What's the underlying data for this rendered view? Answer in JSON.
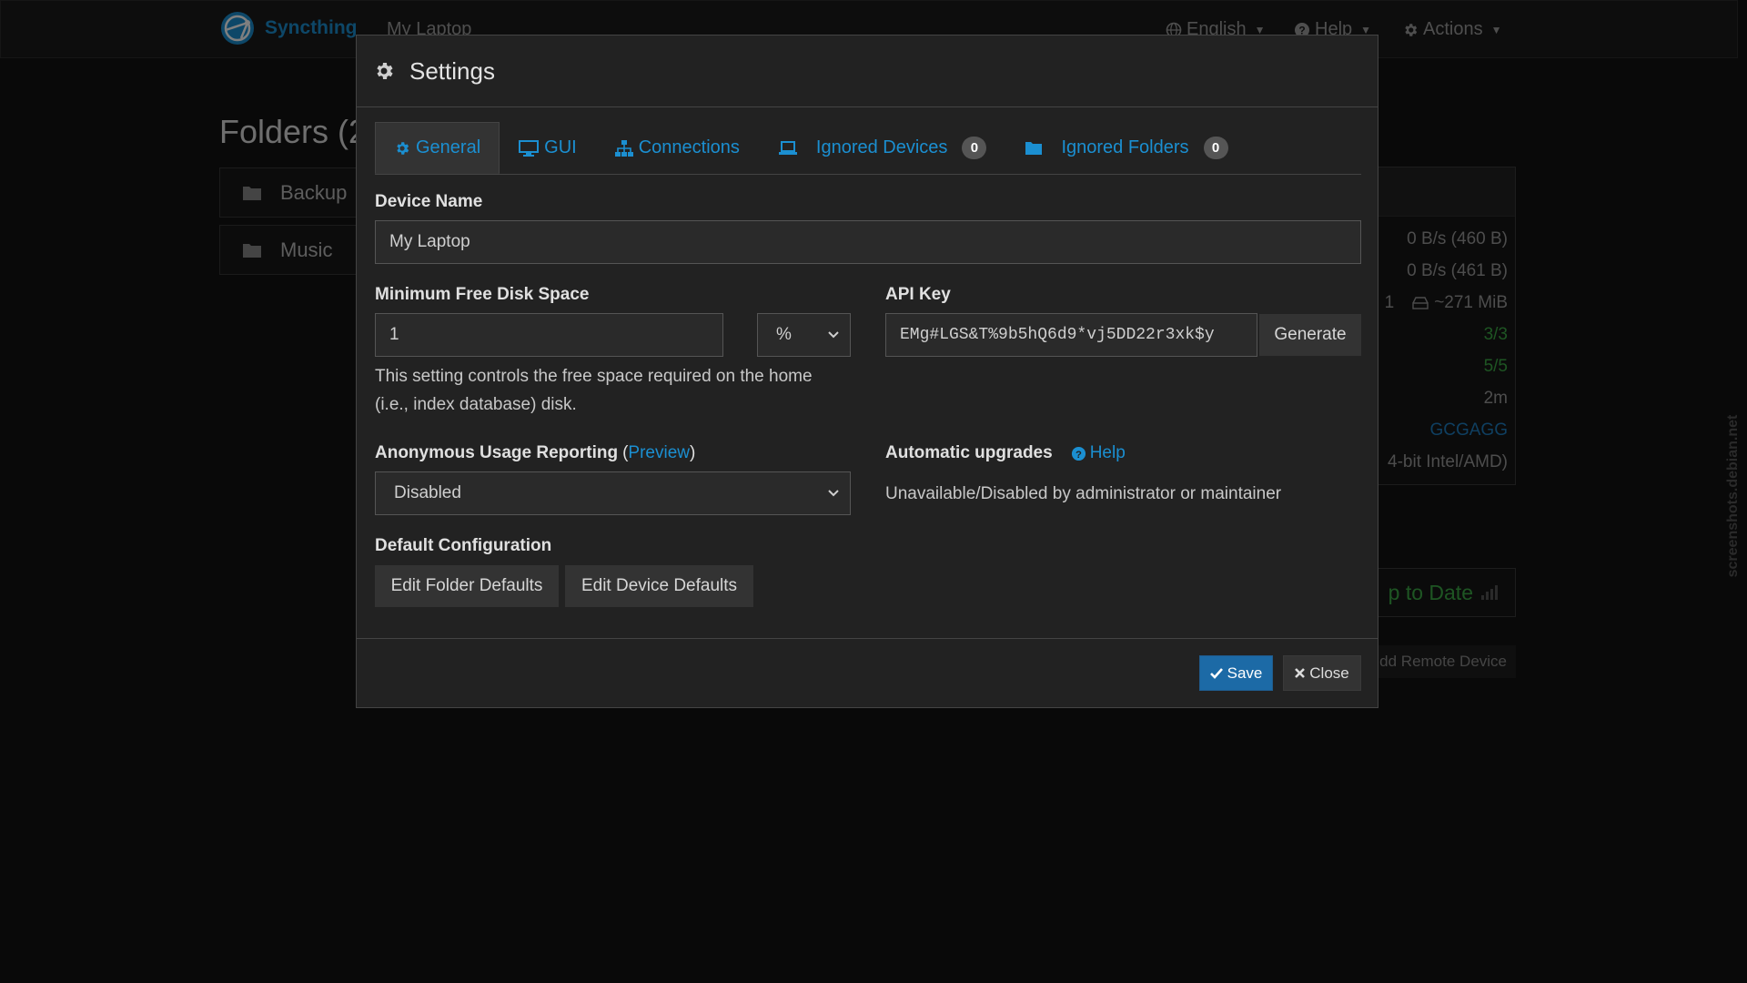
{
  "navbar": {
    "brand": "Syncthing",
    "device_name": "My Laptop",
    "language_label": "English",
    "help_label": "Help",
    "actions_label": "Actions"
  },
  "folders": {
    "title": "Folders (2",
    "items": [
      {
        "label": "Backup"
      },
      {
        "label": "Music"
      }
    ]
  },
  "this_device": {
    "download_rate": "0 B/s (460 B)",
    "upload_rate": "0 B/s (461 B)",
    "local_state_count": "1",
    "local_state_size": "~271 MiB",
    "listeners": "3/3",
    "discovery": "5/5",
    "uptime": "2m",
    "identification": "GCGAGG",
    "version": "4-bit Intel/AMD)"
  },
  "remote": {
    "status": "p to Date",
    "add_remote_label": "dd Remote Device"
  },
  "watermark": "screenshots.debian.net",
  "modal": {
    "title": "Settings",
    "tabs": [
      {
        "label": "General"
      },
      {
        "label": "GUI"
      },
      {
        "label": "Connections"
      },
      {
        "label": "Ignored Devices",
        "badge": "0"
      },
      {
        "label": "Ignored Folders",
        "badge": "0"
      }
    ],
    "device_name": {
      "label": "Device Name",
      "value": "My Laptop"
    },
    "min_disk": {
      "label": "Minimum Free Disk Space",
      "value": "1",
      "unit": "%",
      "help_line1": "This setting controls the free space required on the home",
      "help_line2": "(i.e., index database) disk."
    },
    "api_key": {
      "label": "API Key",
      "value": "EMg#LGS&T%9b5hQ6d9*vj5DD22r3xk$y",
      "generate_label": "Generate"
    },
    "usage_reporting": {
      "label": "Anonymous Usage Reporting",
      "open_paren": "(",
      "preview_label": "Preview",
      "close_paren": ")",
      "selected": "Disabled"
    },
    "auto_upgrades": {
      "label": "Automatic upgrades",
      "help_label": "Help",
      "status": "Unavailable/Disabled by administrator or maintainer"
    },
    "default_config": {
      "label": "Default Configuration",
      "edit_folder_label": "Edit Folder Defaults",
      "edit_device_label": "Edit Device Defaults"
    },
    "footer": {
      "save_label": "Save",
      "close_label": "Close"
    }
  },
  "colors": {
    "accent": "#1b8fd1",
    "primary_button": "#1c6aa6",
    "success": "#3cab46",
    "background": "#121212",
    "modal_background": "#222222"
  }
}
